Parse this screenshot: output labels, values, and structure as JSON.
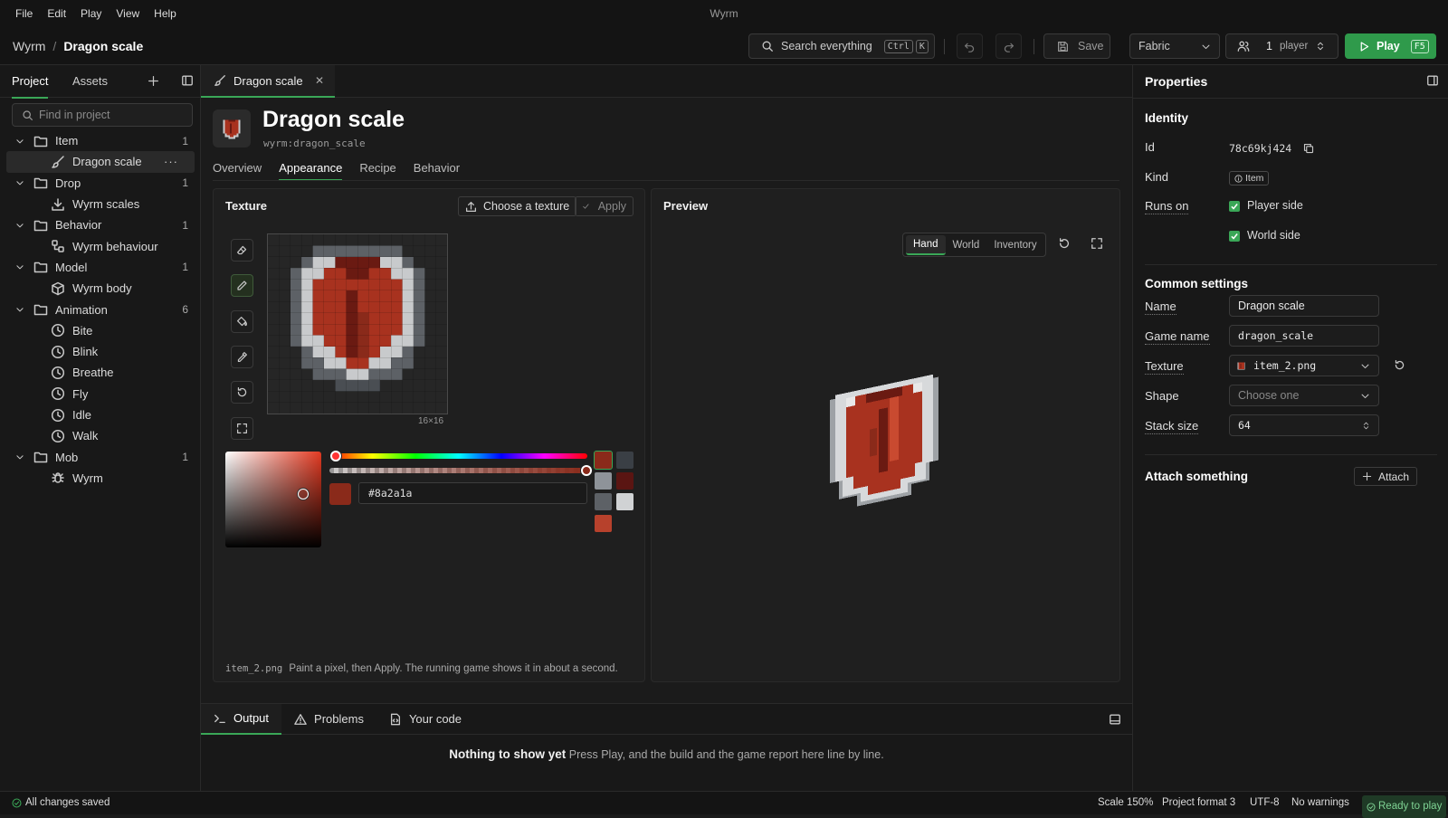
{
  "menu": [
    "File",
    "Edit",
    "Play",
    "View",
    "Help"
  ],
  "window_title": "Wyrm",
  "breadcrumb": {
    "root": "Wyrm",
    "separator": "/",
    "current": "Dragon scale"
  },
  "toolbar": {
    "search_label": "Search everything",
    "search_kbd": [
      "Ctrl",
      "K"
    ],
    "save_label": "Save",
    "loader": "Fabric",
    "players_count": "1",
    "players_label": "player",
    "play_label": "Play",
    "play_kbd": "F5"
  },
  "left": {
    "tabs": [
      "Project",
      "Assets"
    ],
    "find_placeholder": "Find in project",
    "tree": [
      {
        "label": "Item",
        "count": "1",
        "children": [
          {
            "label": "Dragon scale",
            "icon": "brush-icon",
            "selected": true
          }
        ]
      },
      {
        "label": "Drop",
        "count": "1",
        "children": [
          {
            "label": "Wyrm scales",
            "icon": "download-icon"
          }
        ]
      },
      {
        "label": "Behavior",
        "count": "1",
        "children": [
          {
            "label": "Wyrm behaviour",
            "icon": "nodes-icon"
          }
        ]
      },
      {
        "label": "Model",
        "count": "1",
        "children": [
          {
            "label": "Wyrm body",
            "icon": "cube-icon"
          }
        ]
      },
      {
        "label": "Animation",
        "count": "6",
        "children": [
          {
            "label": "Bite",
            "icon": "clock-icon"
          },
          {
            "label": "Blink",
            "icon": "clock-icon"
          },
          {
            "label": "Breathe",
            "icon": "clock-icon"
          },
          {
            "label": "Fly",
            "icon": "clock-icon"
          },
          {
            "label": "Idle",
            "icon": "clock-icon"
          },
          {
            "label": "Walk",
            "icon": "clock-icon"
          }
        ]
      },
      {
        "label": "Mob",
        "count": "1",
        "children": [
          {
            "label": "Wyrm",
            "icon": "bug-icon"
          }
        ]
      }
    ]
  },
  "editor": {
    "tab_label": "Dragon scale",
    "title": "Dragon scale",
    "asset_id": "wyrm:dragon_scale",
    "subtabs": [
      "Overview",
      "Appearance",
      "Recipe",
      "Behavior"
    ],
    "active_subtab": "Appearance",
    "texture": {
      "title": "Texture",
      "choose_label": "Choose a texture",
      "apply_label": "Apply",
      "grid_size": "16×16",
      "hex": "#8a2a1a",
      "palette": [
        "#8a2a1a",
        "#3a3f45",
        "#8e9399",
        "#5a1512",
        "#5d6166",
        "#d0d2d4",
        "#b7412c"
      ],
      "footer_file": "item_2.png",
      "footer_text": "Paint a pixel, then Apply. The running game shows it in about a second."
    },
    "preview": {
      "title": "Preview",
      "modes": [
        "Hand",
        "World",
        "Inventory"
      ],
      "active_mode": "Hand"
    }
  },
  "bottom": {
    "tabs": [
      "Output",
      "Problems",
      "Your code"
    ],
    "empty_title": "Nothing to show yet",
    "empty_text": "Press Play, and the build and the game report here line by line."
  },
  "properties": {
    "title": "Properties",
    "identity_title": "Identity",
    "id_label": "Id",
    "id_value": "78c69kj424",
    "kind_label": "Kind",
    "kind_value": "Item",
    "runs_on_label": "Runs on",
    "runs_on": [
      "Player side",
      "World side"
    ],
    "common_title": "Common settings",
    "name_label": "Name",
    "name_value": "Dragon scale",
    "game_name_label": "Game name",
    "game_name_value": "dragon_scale",
    "texture_label": "Texture",
    "texture_value": "item_2.png",
    "shape_label": "Shape",
    "shape_placeholder": "Choose one",
    "stack_label": "Stack size",
    "stack_value": "64",
    "attach_title": "Attach something",
    "attach_label": "Attach"
  },
  "status": {
    "saved": "All changes saved",
    "scale": "Scale 150%",
    "format": "Project format 3",
    "encoding": "UTF-8",
    "warnings": "No warnings",
    "ready": "Ready to play"
  },
  "colors": {
    "accent": "#3aa757",
    "play_button": "#2f9a4b",
    "scale_red": "#a8321f",
    "scale_dark": "#6a1a12"
  }
}
